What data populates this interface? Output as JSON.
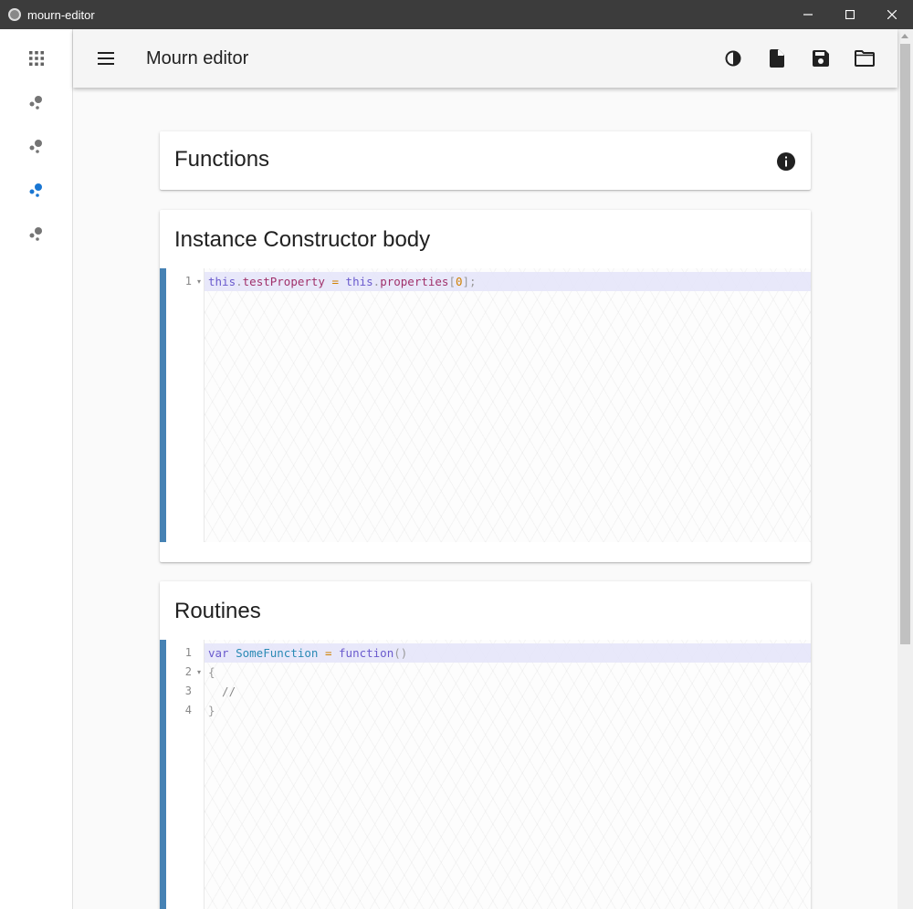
{
  "window": {
    "title": "mourn-editor"
  },
  "rail": {
    "items": [
      {
        "icon": "apps-grid-icon"
      },
      {
        "icon": "bubbles-icon"
      },
      {
        "icon": "bubbles-icon"
      },
      {
        "icon": "bubbles-icon",
        "active": true
      },
      {
        "icon": "bubbles-icon"
      }
    ],
    "accent_color": "#1976d2",
    "inactive_color": "#757575"
  },
  "toolbar": {
    "title": "Mourn editor",
    "actions": [
      "contrast-icon",
      "new-file-icon",
      "save-icon",
      "open-folder-icon"
    ]
  },
  "cards": {
    "functions": {
      "title": "Functions",
      "info_icon": "info-icon"
    },
    "constructor": {
      "title": "Instance Constructor body",
      "lines": [
        {
          "num": "1",
          "fold": true,
          "tokens": [
            {
              "t": "this",
              "c": "kw"
            },
            {
              "t": ".",
              "c": "punc"
            },
            {
              "t": "testProperty",
              "c": "prop"
            },
            {
              "t": " ",
              "c": ""
            },
            {
              "t": "=",
              "c": "op"
            },
            {
              "t": " ",
              "c": ""
            },
            {
              "t": "this",
              "c": "kw"
            },
            {
              "t": ".",
              "c": "punc"
            },
            {
              "t": "properties",
              "c": "prop"
            },
            {
              "t": "[",
              "c": "punc"
            },
            {
              "t": "0",
              "c": "num"
            },
            {
              "t": "]",
              "c": "punc"
            },
            {
              "t": ";",
              "c": "punc"
            }
          ]
        }
      ]
    },
    "routines": {
      "title": "Routines",
      "lines": [
        {
          "num": "1",
          "fold": false,
          "tokens": [
            {
              "t": "var",
              "c": "kw"
            },
            {
              "t": " ",
              "c": ""
            },
            {
              "t": "SomeFunction",
              "c": "fn"
            },
            {
              "t": " ",
              "c": ""
            },
            {
              "t": "=",
              "c": "op"
            },
            {
              "t": " ",
              "c": ""
            },
            {
              "t": "function",
              "c": "kw"
            },
            {
              "t": "()",
              "c": "punc"
            }
          ]
        },
        {
          "num": "2",
          "fold": true,
          "tokens": [
            {
              "t": "{",
              "c": "punc"
            }
          ]
        },
        {
          "num": "3",
          "fold": false,
          "tokens": [
            {
              "t": "  //",
              "c": "cm"
            }
          ]
        },
        {
          "num": "4",
          "fold": false,
          "tokens": [
            {
              "t": "}",
              "c": "punc"
            }
          ]
        }
      ]
    }
  },
  "colors": {
    "editor_bar": "#4682b4",
    "active_line": "#e6e6fa"
  }
}
